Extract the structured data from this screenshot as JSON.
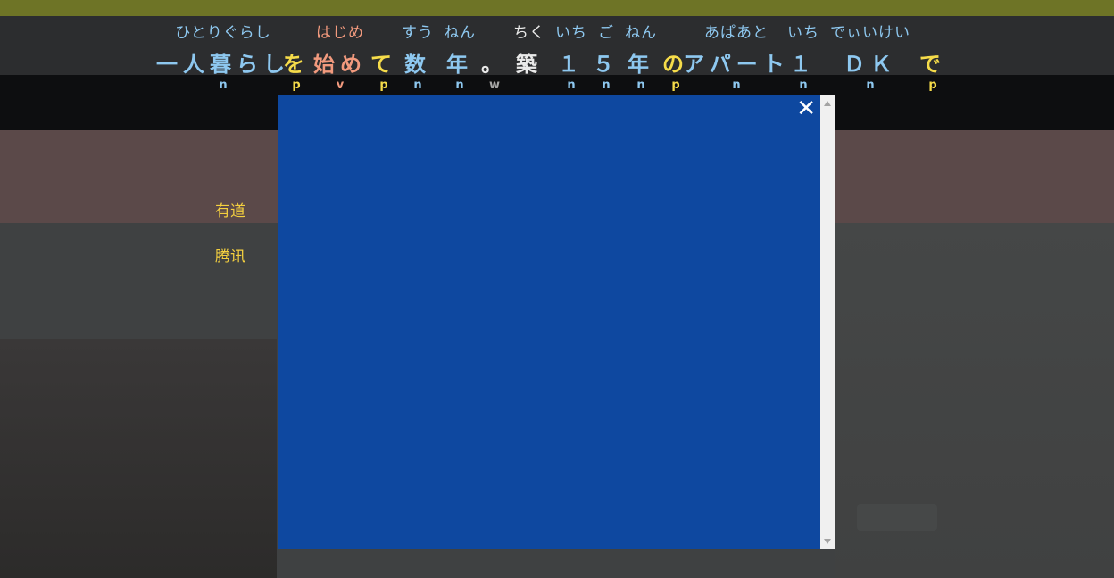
{
  "subtitle": {
    "tokens": [
      {
        "ruby": "ひとりぐらし",
        "text": "一人暮らし",
        "pos": "n",
        "cls": "n"
      },
      {
        "ruby": "",
        "text": "を",
        "pos": "p",
        "cls": "p"
      },
      {
        "ruby": "はじめ",
        "text": "始め",
        "pos": "v",
        "cls": "v"
      },
      {
        "ruby": "",
        "text": "て",
        "pos": "p",
        "cls": "p"
      },
      {
        "ruby": "すう",
        "text": "数",
        "pos": "n",
        "cls": "n"
      },
      {
        "ruby": "ねん",
        "text": "年",
        "pos": "n",
        "cls": "n"
      },
      {
        "ruby": "",
        "text": "。",
        "pos": "w",
        "cls": "w"
      },
      {
        "ruby": "ちく",
        "text": "築",
        "pos": "",
        "cls": "w"
      },
      {
        "ruby": "いち",
        "text": "１",
        "pos": "n",
        "cls": "n"
      },
      {
        "ruby": "ご",
        "text": "５",
        "pos": "n",
        "cls": "n"
      },
      {
        "ruby": "ねん",
        "text": "年",
        "pos": "n",
        "cls": "n"
      },
      {
        "ruby": "",
        "text": "の",
        "pos": "p",
        "cls": "p"
      },
      {
        "ruby": "あぱあと",
        "text": "アパート",
        "pos": "n",
        "cls": "n"
      },
      {
        "ruby": "いち",
        "text": "１",
        "pos": "n",
        "cls": "n"
      },
      {
        "ruby": "でぃいけい",
        "text": "ＤＫ",
        "pos": "n",
        "cls": "n"
      },
      {
        "ruby": "",
        "text": "で",
        "pos": "p",
        "cls": "p"
      }
    ]
  },
  "dictionary_links": [
    "有道",
    "腾讯"
  ],
  "modal": {
    "close_label": "✕",
    "background": "#0e48a0"
  },
  "colors": {
    "noun": "#8ec8f0",
    "particle": "#f6dc4a",
    "verb": "#f29a7e",
    "other": "#eaeaea"
  }
}
